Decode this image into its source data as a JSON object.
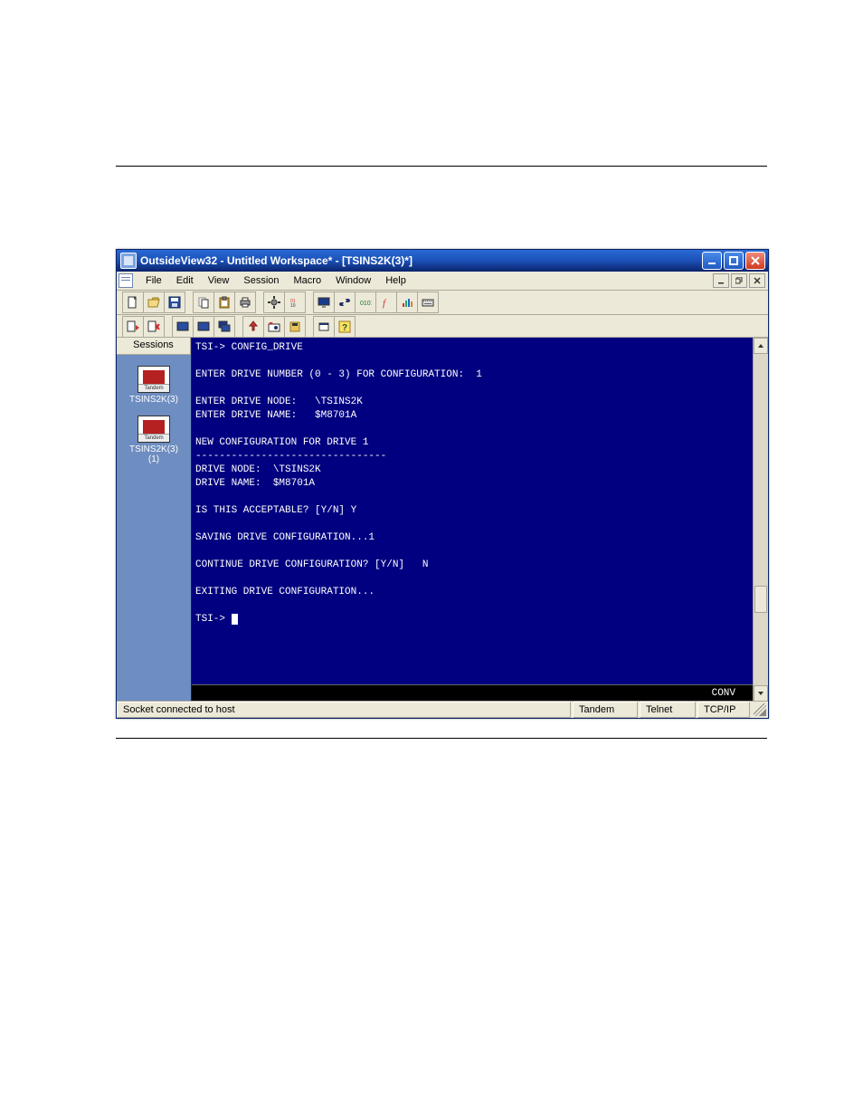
{
  "window": {
    "title": "OutsideView32 - Untitled Workspace* - [TSINS2K(3)*]"
  },
  "menu": {
    "items": [
      "File",
      "Edit",
      "View",
      "Session",
      "Macro",
      "Window",
      "Help"
    ]
  },
  "sidebar": {
    "header": "Sessions",
    "items": [
      {
        "label": "TSINS2K(3)"
      },
      {
        "label": "TSINS2K(3)\n(1)"
      }
    ]
  },
  "terminal": {
    "lines": [
      "TSI-> CONFIG_DRIVE",
      "",
      "ENTER DRIVE NUMBER (0 - 3) FOR CONFIGURATION:  1",
      "",
      "ENTER DRIVE NODE:   \\TSINS2K",
      "ENTER DRIVE NAME:   $M8701A",
      "",
      "NEW CONFIGURATION FOR DRIVE 1",
      "--------------------------------",
      "DRIVE NODE:  \\TSINS2K",
      "DRIVE NAME:  $M8701A",
      "",
      "IS THIS ACCEPTABLE? [Y/N] Y",
      "",
      "SAVING DRIVE CONFIGURATION...1",
      "",
      "CONTINUE DRIVE CONFIGURATION? [Y/N]   N",
      "",
      "EXITING DRIVE CONFIGURATION...",
      "",
      "TSI-> "
    ],
    "status_right": "CONV"
  },
  "statusbar": {
    "left": "Socket connected to host",
    "cells": [
      "Tandem",
      "Telnet",
      "TCP/IP"
    ]
  }
}
